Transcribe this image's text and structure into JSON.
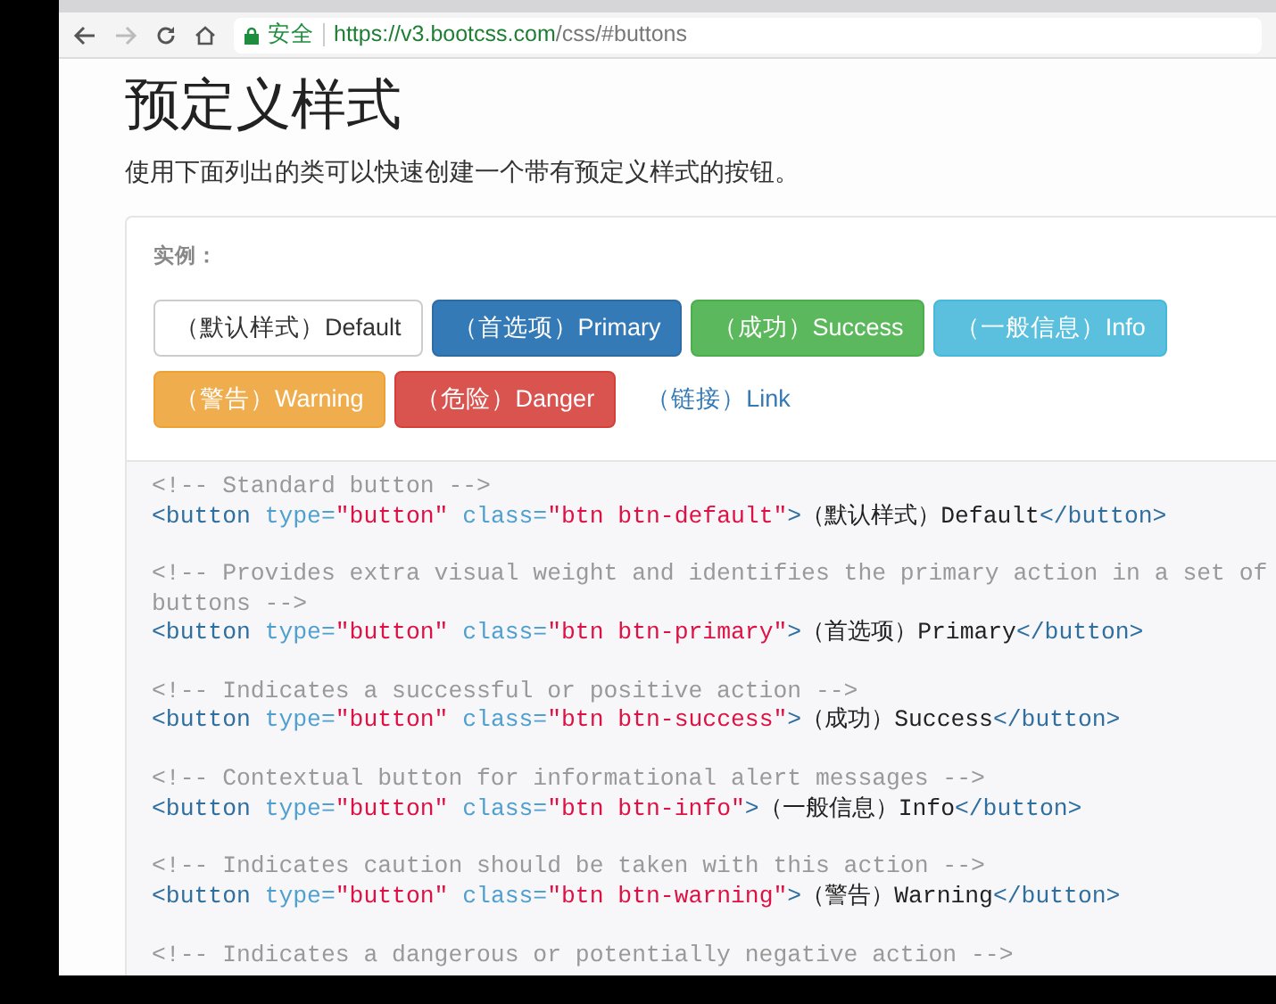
{
  "browser": {
    "secure_label": "安全",
    "url_host": "https://v3.bootcss.com",
    "url_path": "/css/#buttons"
  },
  "heading": "预定义样式",
  "intro": "使用下面列出的类可以快速创建一个带有预定义样式的按钮。",
  "example_label": "实例：",
  "buttons": [
    {
      "label": "（默认样式）Default",
      "kind": "default"
    },
    {
      "label": "（首选项）Primary",
      "kind": "primary"
    },
    {
      "label": "（成功）Success",
      "kind": "success"
    },
    {
      "label": "（一般信息）Info",
      "kind": "info"
    },
    {
      "label": "（警告）Warning",
      "kind": "warning"
    },
    {
      "label": "（危险）Danger",
      "kind": "danger"
    },
    {
      "label": "（链接）Link",
      "kind": "link"
    }
  ],
  "code": [
    {
      "comment_lines": [
        "<!-- Standard button -->"
      ],
      "tokens": [
        {
          "kind": "tag",
          "text": "<button"
        },
        {
          "kind": "attr",
          "text": "type="
        },
        {
          "kind": "string",
          "text": "\"button\""
        },
        {
          "kind": "attr",
          "text": "class="
        },
        {
          "kind": "string",
          "text": "\"btn btn-default\""
        },
        {
          "kind": "tag",
          "text": ">"
        },
        {
          "kind": "text",
          "text": "（默认样式）Default"
        },
        {
          "kind": "tag",
          "text": "</button>"
        }
      ]
    },
    {
      "comment_lines": [
        "<!-- Provides extra visual weight and identifies the primary action in a set of",
        "buttons -->"
      ],
      "tokens": [
        {
          "kind": "tag",
          "text": "<button"
        },
        {
          "kind": "attr",
          "text": "type="
        },
        {
          "kind": "string",
          "text": "\"button\""
        },
        {
          "kind": "attr",
          "text": "class="
        },
        {
          "kind": "string",
          "text": "\"btn btn-primary\""
        },
        {
          "kind": "tag",
          "text": ">"
        },
        {
          "kind": "text",
          "text": "（首选项）Primary"
        },
        {
          "kind": "tag",
          "text": "</button>"
        }
      ]
    },
    {
      "comment_lines": [
        "<!-- Indicates a successful or positive action -->"
      ],
      "tokens": [
        {
          "kind": "tag",
          "text": "<button"
        },
        {
          "kind": "attr",
          "text": "type="
        },
        {
          "kind": "string",
          "text": "\"button\""
        },
        {
          "kind": "attr",
          "text": "class="
        },
        {
          "kind": "string",
          "text": "\"btn btn-success\""
        },
        {
          "kind": "tag",
          "text": ">"
        },
        {
          "kind": "text",
          "text": "（成功）Success"
        },
        {
          "kind": "tag",
          "text": "</button>"
        }
      ]
    },
    {
      "comment_lines": [
        "<!-- Contextual button for informational alert messages -->"
      ],
      "tokens": [
        {
          "kind": "tag",
          "text": "<button"
        },
        {
          "kind": "attr",
          "text": "type="
        },
        {
          "kind": "string",
          "text": "\"button\""
        },
        {
          "kind": "attr",
          "text": "class="
        },
        {
          "kind": "string",
          "text": "\"btn btn-info\""
        },
        {
          "kind": "tag",
          "text": ">"
        },
        {
          "kind": "text",
          "text": "（一般信息）Info"
        },
        {
          "kind": "tag",
          "text": "</button>"
        }
      ]
    },
    {
      "comment_lines": [
        "<!-- Indicates caution should be taken with this action -->"
      ],
      "tokens": [
        {
          "kind": "tag",
          "text": "<button"
        },
        {
          "kind": "attr",
          "text": "type="
        },
        {
          "kind": "string",
          "text": "\"button\""
        },
        {
          "kind": "attr",
          "text": "class="
        },
        {
          "kind": "string",
          "text": "\"btn btn-warning\""
        },
        {
          "kind": "tag",
          "text": ">"
        },
        {
          "kind": "text",
          "text": "（警告）Warning"
        },
        {
          "kind": "tag",
          "text": "</button>"
        }
      ]
    },
    {
      "comment_lines": [
        "<!-- Indicates a dangerous or potentially negative action -->"
      ]
    }
  ]
}
